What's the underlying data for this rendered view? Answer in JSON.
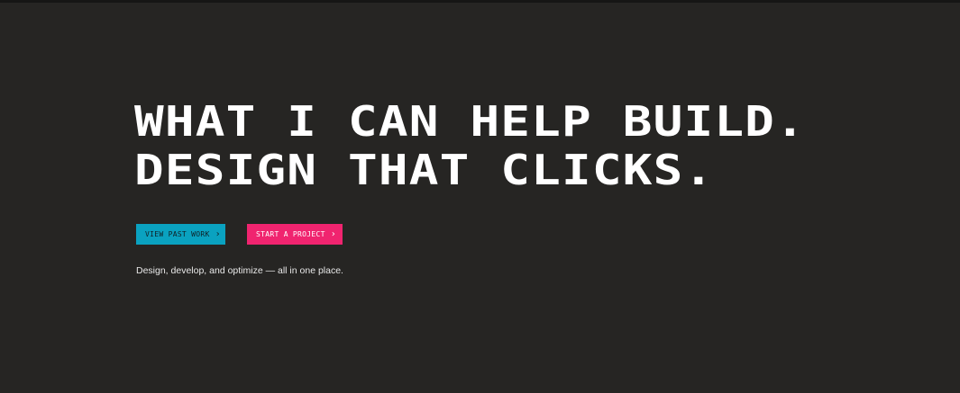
{
  "hero": {
    "headline_line_1": "WHAT I CAN HELP BUILD.",
    "headline_line_2": "DESIGN THAT CLICKS.",
    "tagline": "Design, develop, and optimize — all in one place."
  },
  "buttons": {
    "view_past_work": {
      "label": "VIEW PAST WORK",
      "icon": "chevron-right-icon",
      "glyph": "›"
    },
    "start_project": {
      "label": "START A PROJECT",
      "icon": "chevron-right-icon",
      "glyph": "›"
    }
  },
  "colors": {
    "background": "#262523",
    "accent_cyan": "#0aa2c0",
    "accent_pink": "#f0246f",
    "text": "#ffffff"
  }
}
